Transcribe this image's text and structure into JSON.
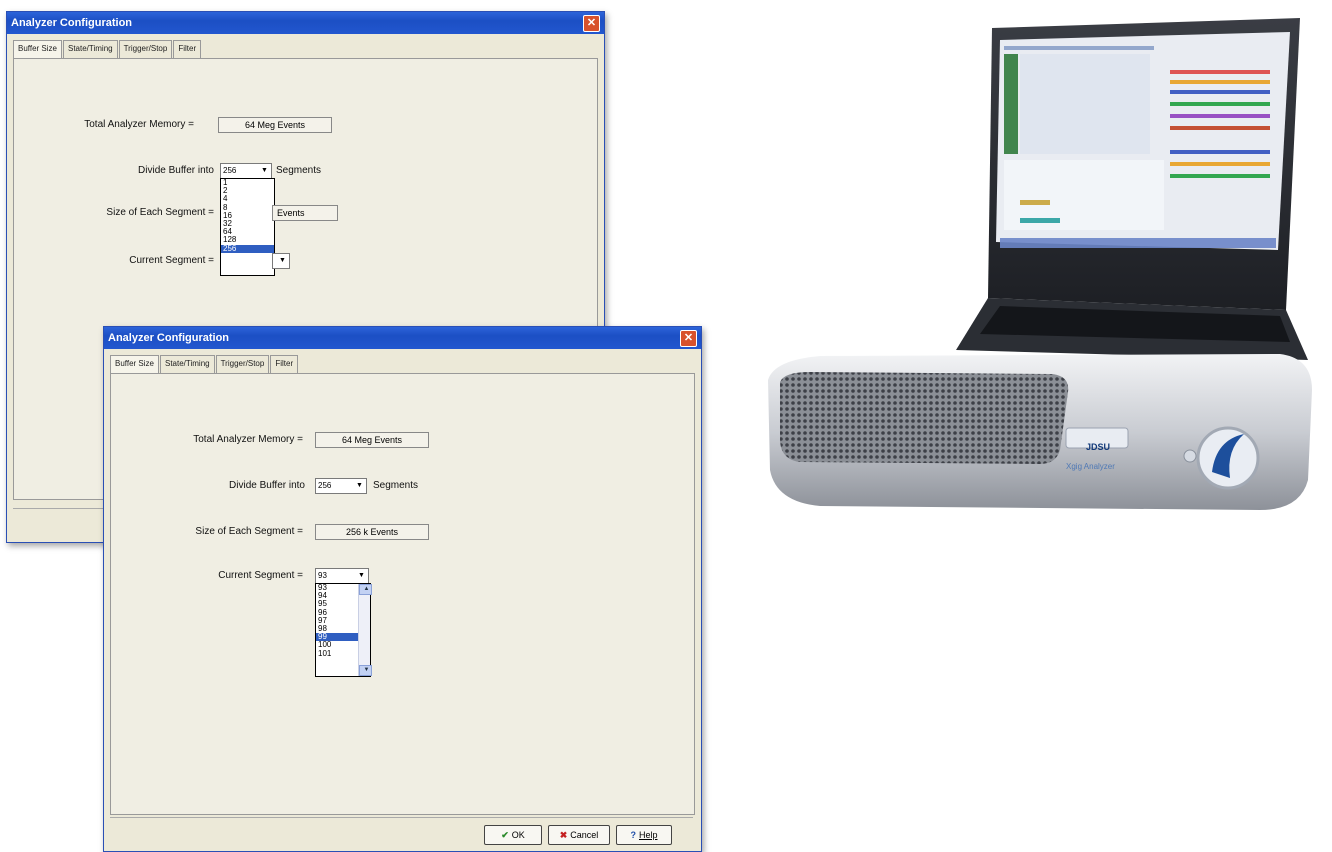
{
  "window_back": {
    "title": "Analyzer Configuration",
    "tabs": [
      "Buffer Size",
      "State/Timing",
      "Trigger/Stop",
      "Filter"
    ],
    "total_memory_label": "Total Analyzer Memory =",
    "total_memory_value": "64 Meg Events",
    "divide_label": "Divide Buffer into",
    "divide_value": "256",
    "segments_label": "Segments",
    "segment_size_label": "Size of Each Segment =",
    "segment_size_value": "Events",
    "current_segment_label": "Current Segment =",
    "divide_options": [
      "1",
      "2",
      "4",
      "8",
      "16",
      "32",
      "64",
      "128",
      "256"
    ],
    "divide_selected": "256"
  },
  "window_front": {
    "title": "Analyzer Configuration",
    "tabs": [
      "Buffer Size",
      "State/Timing",
      "Trigger/Stop",
      "Filter"
    ],
    "total_memory_label": "Total Analyzer Memory =",
    "total_memory_value": "64 Meg Events",
    "divide_label": "Divide Buffer into",
    "divide_value": "256",
    "segments_label": "Segments",
    "segment_size_label": "Size of Each Segment =",
    "segment_size_value": "256 k Events",
    "current_segment_label": "Current Segment =",
    "current_segment_value": "93",
    "segment_options": [
      "93",
      "94",
      "95",
      "96",
      "97",
      "98",
      "99",
      "100",
      "101"
    ],
    "segment_selected": "99",
    "buttons": {
      "ok": "OK",
      "cancel": "Cancel",
      "help": "Help"
    }
  },
  "device": {
    "brand": "JDSU",
    "product": "Xgig Analyzer"
  },
  "colors": {
    "title_blue": "#1c4fc4",
    "dialog_bg": "#ece9d8",
    "selection": "#2f5ec1",
    "close_red": "#d8522c",
    "ok_green": "#2a8a2a",
    "cancel_red": "#c42020",
    "help_blue": "#1f4ea8"
  }
}
